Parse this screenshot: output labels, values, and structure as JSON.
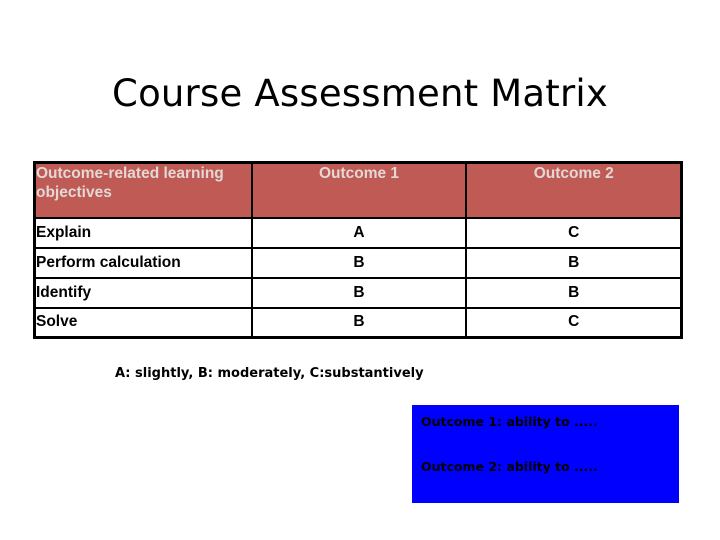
{
  "slide": {
    "title": "Course Assessment Matrix",
    "background_color": "#FFFFFF"
  },
  "matrix": {
    "header_background_color": "#BF5A55",
    "header_text_color": "#E2D8D5",
    "border_color": "#000000",
    "columns": [
      {
        "label": "Outcome-related learning objectives",
        "align": "left"
      },
      {
        "label": "Outcome 1",
        "align": "center"
      },
      {
        "label": "Outcome 2",
        "align": "center"
      }
    ],
    "rows": [
      {
        "objective": "Explain",
        "outcome1": "A",
        "outcome2": "C"
      },
      {
        "objective": "Perform calculation",
        "outcome1": "B",
        "outcome2": "B"
      },
      {
        "objective": "Identify",
        "outcome1": "B",
        "outcome2": "B"
      },
      {
        "objective": "Solve",
        "outcome1": "B",
        "outcome2": "C"
      }
    ]
  },
  "legend": {
    "text": "A: slightly, B: moderately, C:substantively"
  },
  "outcome_box": {
    "background_color": "#0000FF",
    "text_color": "#000000",
    "lines": [
      "Outcome 1: ability to .....",
      "Outcome 2: ability to ....."
    ]
  }
}
